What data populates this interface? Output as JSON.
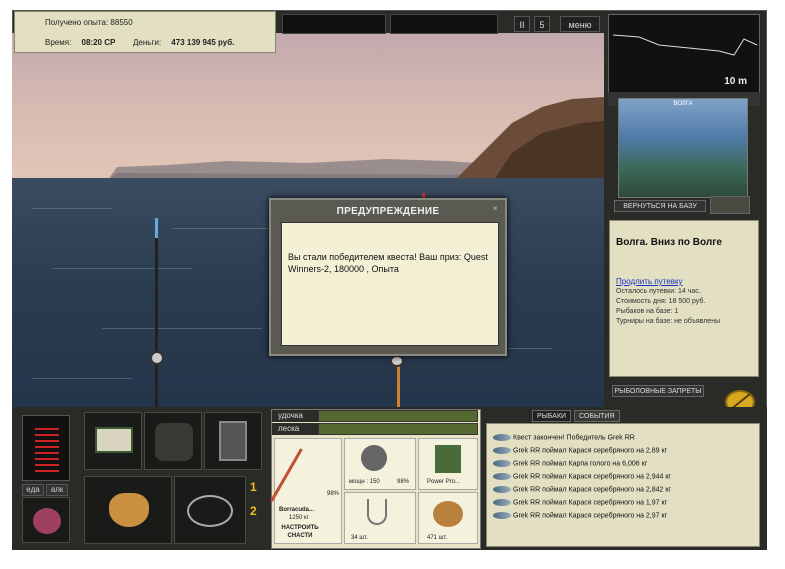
{
  "info": {
    "xp_label": "Получено опыта:",
    "xp_value": "88550",
    "time_label": "Время:",
    "time_value": "08:20 СР",
    "money_label": "Деньги:",
    "money_value": "473 139 945 руб."
  },
  "topbar": {
    "pause": "II",
    "speed": "5",
    "menu": "меню"
  },
  "depth": {
    "value": "10 m"
  },
  "location": {
    "photo_title": "ВОЛГА",
    "back_button": "ВЕРНУТЬСЯ НА БАЗУ",
    "title": "Волга. Вниз по Волге",
    "extend_link": "Продлить путевку",
    "lines": [
      "Осталось путевки: 14 час.",
      "Стоимость дня: 18 500 руб.",
      "Рыбаков на базе: 1",
      "Турниры на базе: не объявлены"
    ],
    "bans_button": "РЫБОЛОВНЫЕ ЗАПРЕТЫ"
  },
  "dialog": {
    "title": "ПРЕДУПРЕЖДЕНИЕ",
    "message": "Вы стали победителем квеста! Ваш приз: Quest Winners-2, 180000 , Опыта"
  },
  "food_tabs": {
    "food": "еда",
    "alco": "алк"
  },
  "slots": {
    "num1": "1",
    "num2": "2"
  },
  "tackle": {
    "rod_label": "удочка",
    "line_label": "леска",
    "rod_pct": "98%",
    "rod_name": "Borracuda...",
    "rod_weight": "1250 кг",
    "setup_button": "НАСТРОИТЬ СНАСТИ",
    "reel_power": "мощн : 150",
    "reel_pct": "98%",
    "bait_name": "Power Pro...",
    "hooks_count": "34 шт.",
    "food_count": "471 шт."
  },
  "log": {
    "tab_fishers": "РЫБАКИ",
    "tab_events": "СОБЫТИЯ",
    "entries": [
      "Квест закончен! Победитель Grek RR",
      "Grek RR поймал Карася серебряного на 2,89 кг",
      "Grek RR поймал Карпа голого на 6,006 кг",
      "Grek RR поймал Карася серебряного на 2,944 кг",
      "Grek RR поймал Карася серебряного на 2,842 кг",
      "Grek RR поймал Карася серебряного на 1,97 кг",
      "Grek RR поймал Карася серебряного на 2,97 кг"
    ]
  },
  "colors": {
    "panel": "#e2dfc2",
    "accent_link": "#1a33c8",
    "gold": "#f0c020"
  }
}
